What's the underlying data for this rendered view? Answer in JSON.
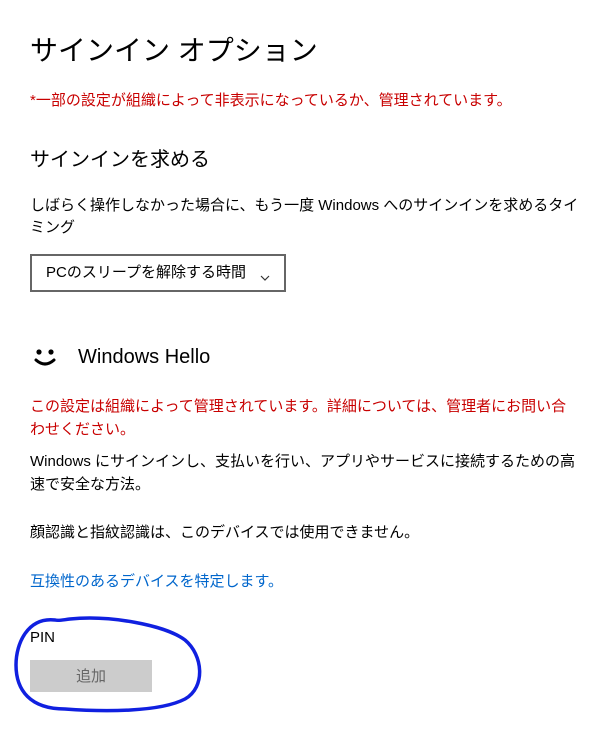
{
  "page": {
    "title": "サインイン オプション",
    "policy_warning": "*一部の設定が組織によって非表示になっているか、管理されています。"
  },
  "require_signin": {
    "heading": "サインインを求める",
    "description": "しばらく操作しなかった場合に、もう一度 Windows へのサインインを求めるタイミング",
    "dropdown_value": "PCのスリープを解除する時間"
  },
  "hello": {
    "title": "Windows Hello",
    "managed_warning": "この設定は組織によって管理されています。詳細については、管理者にお問い合わせください。",
    "description": "Windows にサインインし、支払いを行い、アプリやサービスに接続するための高速で安全な方法。",
    "unavailable": "顔認識と指紋認識は、このデバイスでは使用できません。",
    "link": "互換性のあるデバイスを特定します。"
  },
  "pin": {
    "label": "PIN",
    "button": "追加"
  }
}
